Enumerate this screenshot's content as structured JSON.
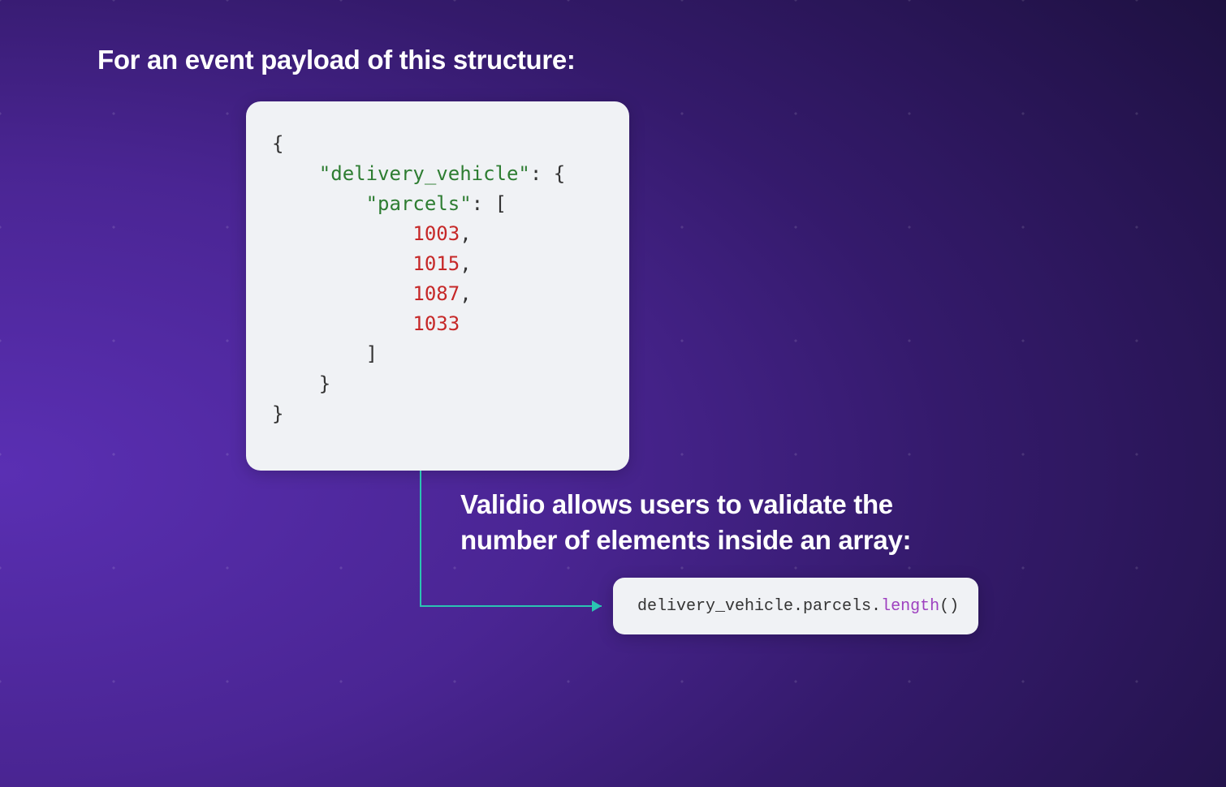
{
  "heading1": "For an event payload of this structure:",
  "heading2": "Validio allows users to validate the number of elements inside an array:",
  "code": {
    "key1": "\"delivery_vehicle\"",
    "key2": "\"parcels\"",
    "values": [
      "1003",
      "1015",
      "1087",
      "1033"
    ]
  },
  "expression": {
    "path": "delivery_vehicle.parcels.",
    "method": "length",
    "parens": "()"
  },
  "arrowColor": "#2bc4b2"
}
